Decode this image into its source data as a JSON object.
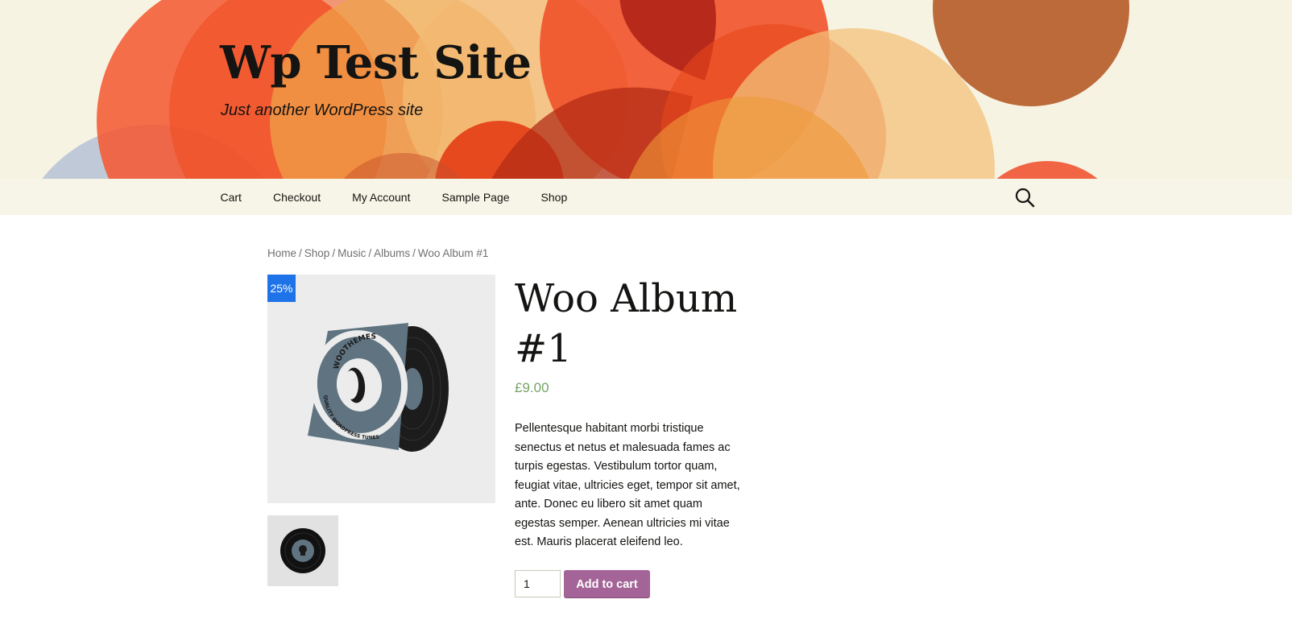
{
  "site": {
    "title": "Wp Test Site",
    "tagline": "Just another WordPress site"
  },
  "nav": {
    "items": [
      {
        "label": "Cart"
      },
      {
        "label": "Checkout"
      },
      {
        "label": "My Account"
      },
      {
        "label": "Sample Page"
      },
      {
        "label": "Shop"
      }
    ],
    "search_icon": "search-icon"
  },
  "breadcrumb": {
    "items": [
      "Home",
      "Shop",
      "Music",
      "Albums"
    ],
    "current": "Woo Album #1",
    "separator": "/"
  },
  "product": {
    "title": "Woo Album #1",
    "sale_badge": "25%",
    "price": "£9.00",
    "description": "Pellentesque habitant morbi tristique senectus et netus et malesuada fames ac turpis egestas. Vestibulum tortor quam, feugiat vitae, ultricies eget, tempor sit amet, ante. Donec eu libero sit amet quam egestas semper. Aenean ultricies mi vitae est. Mauris placerat eleifend leo.",
    "quantity": "1",
    "add_to_cart_label": "Add to cart",
    "cover_text_top": "WOOTHEMES",
    "cover_text_bottom": "QUALITY WORDPRESS TUNES"
  },
  "colors": {
    "header_bg": "#f7f3e3",
    "nav_bg": "#f7f5e7",
    "price": "#77a464",
    "sale_badge": "#1e73e8",
    "add_to_cart": "#a46497"
  }
}
